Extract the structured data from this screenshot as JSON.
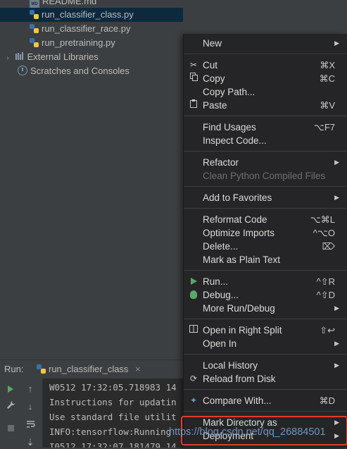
{
  "project_tree": {
    "items": [
      {
        "label": "README.md",
        "icon": "markdown-file-icon"
      },
      {
        "label": "run_classifier_class.py",
        "icon": "python-file-icon"
      },
      {
        "label": "run_classifier_race.py",
        "icon": "python-file-icon"
      },
      {
        "label": "run_pretraining.py",
        "icon": "python-file-icon"
      },
      {
        "label": "External Libraries",
        "icon": "libraries-icon"
      },
      {
        "label": "Scratches and Consoles",
        "icon": "scratches-icon"
      }
    ],
    "md_badge": "MD"
  },
  "run_panel": {
    "title": "Run:",
    "tab_label": "run_classifier_class",
    "tab_close": "×",
    "console_lines": [
      "W0512 17:32:05.718983 14",
      "Instructions for updatin",
      "Use standard file utilit",
      "INFO:tensorflow:Running",
      "I0512 17:32:07.181479 14"
    ]
  },
  "context_menu": {
    "items": [
      {
        "label": "New",
        "shortcut": "",
        "submenu": true
      },
      {
        "label": "Cut",
        "shortcut": "⌘X",
        "icon": "scissors-icon"
      },
      {
        "label": "Copy",
        "shortcut": "⌘C",
        "icon": "copy-icon"
      },
      {
        "label": "Copy Path...",
        "shortcut": ""
      },
      {
        "label": "Paste",
        "shortcut": "⌘V",
        "icon": "paste-icon"
      },
      {
        "label": "Find Usages",
        "shortcut": "⌥F7"
      },
      {
        "label": "Inspect Code...",
        "shortcut": ""
      },
      {
        "label": "Refactor",
        "shortcut": "",
        "submenu": true
      },
      {
        "label": "Clean Python Compiled Files",
        "shortcut": "",
        "disabled": true
      },
      {
        "label": "Add to Favorites",
        "shortcut": "",
        "submenu": true
      },
      {
        "label": "Reformat Code",
        "shortcut": "⌥⌘L"
      },
      {
        "label": "Optimize Imports",
        "shortcut": "^⌥O"
      },
      {
        "label": "Delete...",
        "shortcut": "⌦"
      },
      {
        "label": "Mark as Plain Text",
        "shortcut": ""
      },
      {
        "label": "Run...",
        "shortcut": "^⇧R",
        "icon": "run-icon"
      },
      {
        "label": "Debug...",
        "shortcut": "^⇧D",
        "icon": "debug-icon"
      },
      {
        "label": "More Run/Debug",
        "shortcut": "",
        "submenu": true
      },
      {
        "label": "Open in Right Split",
        "shortcut": "⇧↩",
        "icon": "split-icon"
      },
      {
        "label": "Open In",
        "shortcut": "",
        "submenu": true
      },
      {
        "label": "Local History",
        "shortcut": "",
        "submenu": true
      },
      {
        "label": "Reload from Disk",
        "shortcut": "",
        "icon": "reload-icon"
      },
      {
        "label": "Compare With...",
        "shortcut": "⌘D",
        "icon": "compare-icon"
      },
      {
        "label": "Mark Directory as",
        "shortcut": "",
        "submenu": true
      },
      {
        "label": "Deployment",
        "shortcut": "",
        "submenu": true
      }
    ],
    "submenu_arrow": "▶"
  },
  "watermark": "https://blog.csdn.net/qq_26884501",
  "colors": {
    "background": "#3c3f41",
    "menu_background": "#252527",
    "selection": "#0d293e",
    "highlight_box": "#e23b2e",
    "run_green": "#59a869"
  }
}
